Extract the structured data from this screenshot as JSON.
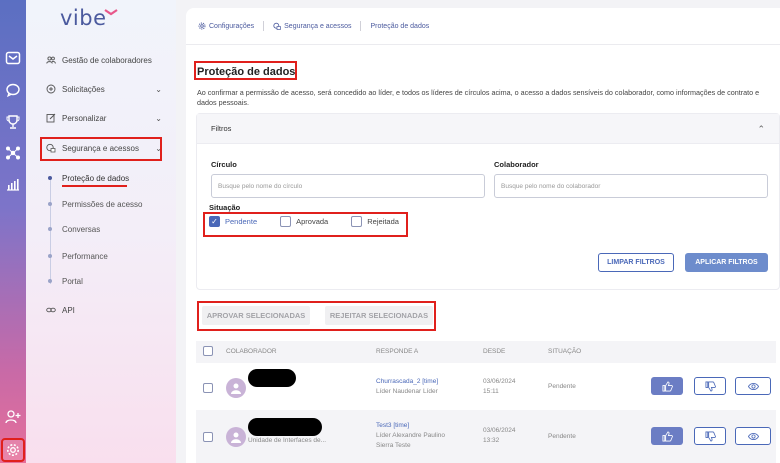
{
  "brand": {
    "logo": "vibe"
  },
  "menu": {
    "items": [
      {
        "label": "Gestão de colaboradores"
      },
      {
        "label": "Solicitações"
      },
      {
        "label": "Personalizar"
      },
      {
        "label": "Segurança e acessos"
      },
      {
        "label": "API"
      }
    ],
    "sub": [
      {
        "label": "Proteção de dados"
      },
      {
        "label": "Permissões de acesso"
      },
      {
        "label": "Conversas"
      },
      {
        "label": "Performance"
      },
      {
        "label": "Portal"
      }
    ]
  },
  "breadcrumb": [
    "Configurações",
    "Segurança e acessos",
    "Proteção de dados"
  ],
  "page": {
    "title": "Proteção de dados",
    "description": "Ao confirmar a permissão de acesso, será concedido ao líder, e todos os líderes de círculos acima, o acesso a dados sensíveis do colaborador, como informações de contrato e dados pessoais."
  },
  "filters": {
    "title": "Filtros",
    "circle_label": "Círculo",
    "circle_placeholder": "Busque pelo nome do círculo",
    "collab_label": "Colaborador",
    "collab_placeholder": "Busque pelo nome do colaborador",
    "status_label": "Situação",
    "options": [
      {
        "label": "Pendente",
        "checked": true
      },
      {
        "label": "Aprovada",
        "checked": false
      },
      {
        "label": "Rejeitada",
        "checked": false
      }
    ],
    "clear": "LIMPAR FILTROS",
    "apply": "APLICAR FILTROS"
  },
  "bulk": {
    "approve": "APROVAR SELECIONADAS",
    "reject": "REJEITAR SELECIONADAS"
  },
  "table": {
    "headers": [
      "COLABORADOR",
      "RESPONDE A",
      "DESDE",
      "SITUAÇÃO"
    ],
    "rows": [
      {
        "collab_sub": "",
        "responde_circle": "Churrascada_2 [time]",
        "responde_leader": "Líder Naudenar Líder",
        "responde_extra": "",
        "date": "03/06/2024",
        "time": "15:11",
        "status": "Pendente"
      },
      {
        "collab_sub": "Unidade de Interfaces de...",
        "responde_circle": "Test3 [time]",
        "responde_leader": "Líder Alexandre Paulino",
        "responde_extra": "Sierra Teste",
        "date": "03/06/2024",
        "time": "13:32",
        "status": "Pendente"
      }
    ]
  },
  "colors": {
    "accent": "#4a68b8",
    "highlight": "#e0201c",
    "rail_top": "#5b6fc2",
    "rail_bottom": "#e66f9a"
  }
}
